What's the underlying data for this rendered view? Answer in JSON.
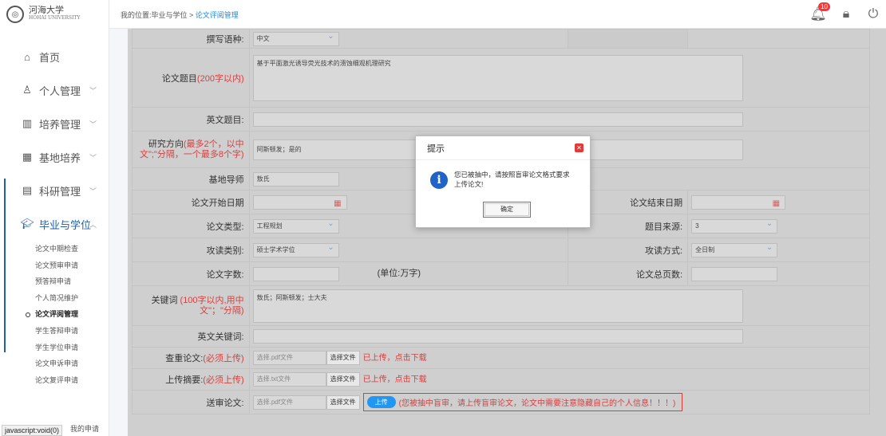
{
  "logo": {
    "name": "河海大学",
    "sub": "HOHAI UNIVERSITY"
  },
  "breadcrumb": {
    "prefix": "我的位置:毕业与学位 > ",
    "current": "论文评阅管理"
  },
  "header": {
    "badge": "10"
  },
  "sidebar": {
    "items": [
      {
        "label": "首页",
        "icon": "home-icon"
      },
      {
        "label": "个人管理",
        "icon": "user-icon"
      },
      {
        "label": "培养管理",
        "icon": "chart-icon"
      },
      {
        "label": "基地培养",
        "icon": "grid-icon"
      },
      {
        "label": "科研管理",
        "icon": "research-icon"
      },
      {
        "label": "毕业与学位",
        "icon": "graduation-cap-icon"
      }
    ],
    "subitems": [
      "论文中期检查",
      "论文预审申请",
      "预答辩申请",
      "个人简况维护",
      "论文评阅管理",
      "学生答辩申请",
      "学生学位申请",
      "论文申诉申请",
      "论文复评申请"
    ],
    "status_url": "javascript:void(0)",
    "footer_item": "我的申请"
  },
  "form": {
    "lang_label": "撰写语种:",
    "lang_value": "中文",
    "title_label": "论文题目",
    "title_hint": "(200字以内)",
    "title_value": "基于平面激光诱导荧光技术的溃蚀细观机理研究",
    "en_title_label": "英文题目:",
    "dir_label": "研究方向",
    "dir_hint": "(最多2个，以中文\";\"分隔，一个最多8个字)",
    "dir_value": "阿斯顿发；是的",
    "mentor_label": "基地导师",
    "mentor_value": "敖氏",
    "start_label": "论文开始日期",
    "end_label": "论文结束日期",
    "type_label": "论文类型:",
    "type_value": "工程规划",
    "source_label": "题目来源:",
    "source_value": "3",
    "degree_label": "攻读类别:",
    "degree_value": "硕士学术学位",
    "mode_label": "攻读方式:",
    "mode_value": "全日制",
    "words_label": "论文字数:",
    "words_unit": "(单位:万字)",
    "pages_label": "论文总页数:",
    "kw_label": "关键词",
    "kw_hint": " (100字以内,用中文\"；\"分隔)",
    "kw_value": "敖氏；阿斯顿发；士大夫",
    "en_kw_label": "英文关键词:",
    "check_label": "查重论文:",
    "check_hint": "(必须上传)",
    "check_placeholder": "选择.pdf文件",
    "abstract_label": "上传摘要:",
    "abstract_hint": "(必须上传)",
    "abstract_placeholder": "选择.txt文件",
    "send_label": "送审论文:",
    "send_placeholder": "选择.pdf文件",
    "choose_file": "选择文件",
    "uploaded_note": "已上传，点击下载",
    "upload_btn": "上传",
    "warn": "(您被抽中盲审，请上传盲审论文，论文中需要注意隐藏自己的个人信息！！！)"
  },
  "dialog": {
    "title": "提示",
    "message": "您已被抽中，请按照盲审论文格式要求上传论文!",
    "ok": "确定"
  }
}
